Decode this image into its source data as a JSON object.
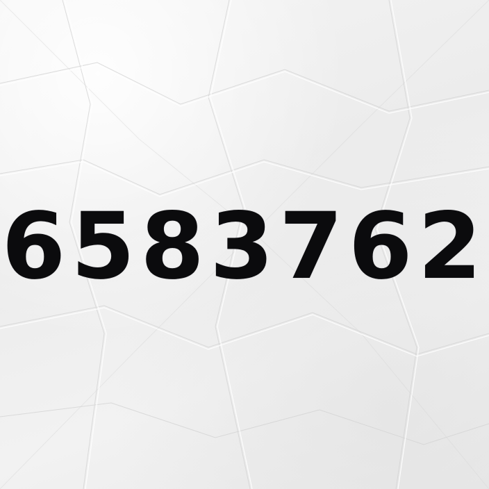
{
  "code": {
    "text": "6583762"
  },
  "colors": {
    "paper": "#efefef",
    "ink": "#0b0b0d"
  }
}
